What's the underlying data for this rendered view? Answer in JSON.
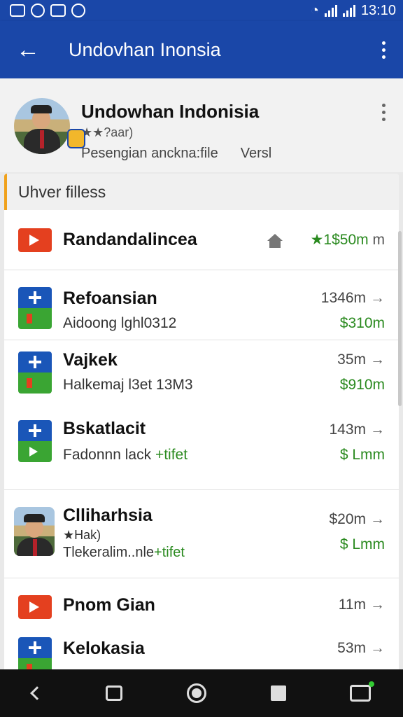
{
  "status_bar": {
    "left_icons": [
      "gallery-icon",
      "clock-icon",
      "app-icon",
      "bird-icon"
    ],
    "right_icons": [
      "wifi-icon",
      "signal-icon",
      "signal-icon"
    ],
    "time": "13:10"
  },
  "app_bar": {
    "title": "Undovhan Inonsia",
    "back_icon": "arrow-left-icon",
    "menu_icon": "more-vert-icon"
  },
  "profile": {
    "name": "Undowhan Indonisia",
    "rating": "★★?aar)",
    "subtitle": "Pesengian anckna:file",
    "subtitle_extra": "Versl"
  },
  "section": {
    "title": "Uhver filless"
  },
  "rows": [
    {
      "title": "Randandalincea",
      "icon": "video-icon",
      "right_top": "★1$50m",
      "right_top_extra": "m"
    },
    {
      "title": "Refoansian",
      "subtitle": "Aidoong lghl0312",
      "icon": "app-tile-icon",
      "right_top": "1346m",
      "right_bottom": "$310m"
    },
    {
      "title": "Vajkek",
      "subtitle": "Halkemaj l3et 13M3",
      "icon": "app-tile-icon",
      "right_top": "35m",
      "right_bottom": "$910m"
    },
    {
      "title": "Bskatlacit",
      "subtitle": "Fadonnn lack",
      "subtitle_accent": "+tifet",
      "icon": "app-tile-icon",
      "right_top": "143m",
      "right_bottom": "$ Lmm"
    },
    {
      "title": "Clliharhsia",
      "subtitle": "★Hak)",
      "subtitle2": "Tlekeralim..nle",
      "subtitle2_accent": "+tifet",
      "icon": "person-avatar",
      "right_top": "$20m",
      "right_bottom": "$ Lmm"
    },
    {
      "title": "Pnom Gian",
      "icon": "video-icon",
      "right_top": "11m"
    },
    {
      "title": "Kelokasia",
      "icon": "app-tile-icon",
      "right_top": "53m"
    }
  ],
  "nav_bar": [
    "back-icon",
    "recent-apps-icon",
    "home-icon",
    "overview-icon",
    "cast-icon"
  ],
  "colors": {
    "primary": "#1a47a8",
    "accent_green": "#2a8a1f",
    "accent_orange": "#f0a11b",
    "red": "#e4401f"
  }
}
